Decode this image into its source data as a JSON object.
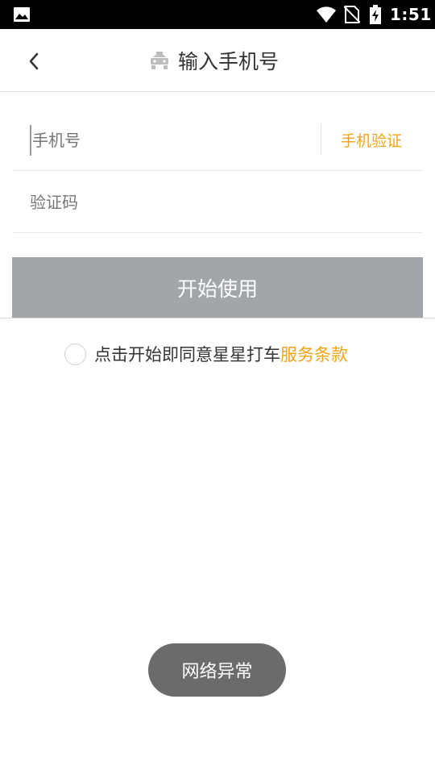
{
  "status_bar": {
    "time": "1:51",
    "icons": [
      "gallery-icon",
      "wifi-icon",
      "no-sim-icon",
      "battery-charging-icon"
    ]
  },
  "header": {
    "title": "输入手机号",
    "back_icon": "chevron-left-icon",
    "title_icon": "taxi-car-icon"
  },
  "form": {
    "phone_placeholder": "手机号",
    "phone_value": "",
    "verify_label": "手机验证",
    "code_placeholder": "验证码",
    "code_value": "",
    "submit_label": "开始使用"
  },
  "agreement": {
    "checked": false,
    "text": "点击开始即同意星星打车",
    "link_text": "服务条款"
  },
  "toast": {
    "message": "网络异常"
  },
  "colors": {
    "accent": "#f0a419",
    "button_disabled": "#a2a6ab",
    "toast_bg": "#6b6b6b"
  }
}
